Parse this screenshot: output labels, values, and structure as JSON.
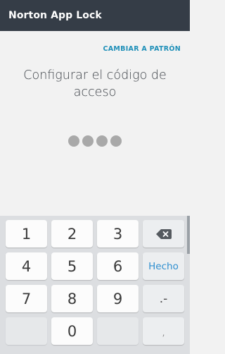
{
  "app_bar": {
    "title": "Norton App Lock"
  },
  "pin_setup": {
    "switch_link": "CAMBIAR A PATRÓN",
    "heading_line1": "Configurar el código de",
    "heading_line2": "acceso",
    "digits_entered": 4
  },
  "keyboard": {
    "row1": [
      "1",
      "2",
      "3"
    ],
    "row2": [
      "4",
      "5",
      "6"
    ],
    "row3": [
      "7",
      "8",
      "9"
    ],
    "row4": [
      "0"
    ],
    "done_label": "Hecho",
    "punct_label": ".-",
    "comma_label": ",",
    "backspace_icon": "backspace-icon"
  },
  "colors": {
    "app_bar": "#353d47",
    "accent_link": "#1e8fb8",
    "done_text": "#2f8fd0",
    "pin_dot": "#a9a9a9"
  }
}
